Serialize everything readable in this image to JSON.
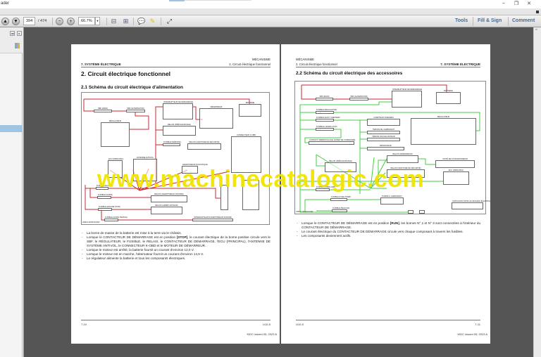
{
  "window": {
    "title": "ader",
    "minimize": "–",
    "restore": "❐",
    "close": "✕"
  },
  "toolbar": {
    "page_current": "394",
    "page_total": "/ 474",
    "zoom": "66.7%",
    "icons": [
      "previous-page-icon",
      "next-page-icon",
      "zoom-out-icon",
      "zoom-in-icon",
      "fit-page-icon",
      "fit-width-icon",
      "comment-icon",
      "highlight-icon",
      "fullscreen-icon"
    ],
    "tools": "Tools",
    "fill_sign": "Fill & Sign",
    "comment": "Comment"
  },
  "colors": {
    "wire_power": "#c8282d",
    "wire_acc": "#44cc44",
    "watermark": "#f1e400",
    "panel_selected": "#9fc5e2"
  },
  "watermark": "www.machinecatalogic.com",
  "left_page": {
    "header_left": "7. SYSTÈME ÉLECTRIQUE",
    "header_right_top": "MÉCANISME",
    "header_right": "2. Circuit électrique fonctionnel",
    "title": "2. Circuit électrique fonctionnel",
    "subtitle": "2.1 Schéma du circuit électrique d'alimentation",
    "diagram": {
      "caption": "2SBUL0005A61IFR",
      "components": [
        "SBF (MAIN)",
        "SBF (ALTERNATOR)",
        "INTERRUPTEUR DE DÉMARRAGE",
        "DÉMARREUR",
        "BATTERIE",
        "RÉGULATEUR",
        "RELAIS (PRÉCHAUFFAGE)",
        "FUSIBLE (DÉMOND)",
        "RELAIS (CEINTURE DE SÉCURITÉ)",
        "CONNECTEUR K-OBD",
        "ECU (PRINCIPAL)",
        "ANTENNE ANTIVOL",
        "AVERTISSEUR ACOUSTIQUE",
        "FUSIBLE (ECU (B))",
        "FUSIBLE (HORN)",
        "RELAIS (AVERTISSEUR SONORE)",
        "FUSIBLE (ENGINE STOP)",
        "RELAIS (ARRÊT MOTEUR)",
        "FUSIBLE (HORN SWITCH)",
        "INTERRUPTEUR D'AVERTISSEUR SONORE"
      ]
    },
    "bullets": [
      {
        "pre": "La borne de masse de la batterie est mise à la terre via le châssis.",
        "bold": "",
        "post": ""
      },
      {
        "pre": "Lorsque le CONTACTEUR DE DÉMARRAGE est en position ",
        "bold": "[STOP]",
        "post": ", le courant électrique de la borne positive circule vers le SBF, le RÉGULATEUR, le FUSIBLE, le RELAIS, le CONTACTEUR DE DÉMARRAGE, l'ECU (PRINCIPAL), l'ANTENNE DE SYSTÈME ANTIVOL, le CONNECTEUR K-OBD et le MOTEUR DE DÉMARREUR."
      },
      {
        "pre": "Lorsque le moteur est arrêté, la batterie fournit un courant d'environ 12,0 V.",
        "bold": "",
        "post": ""
      },
      {
        "pre": "Lorsque le moteur est en marche, l'alternateur fournit un courant d'environ 14,5 V.",
        "bold": "",
        "post": ""
      },
      {
        "pre": "Le régulateur alimente la batterie et tous les composants électriques.",
        "bold": "",
        "post": ""
      }
    ],
    "footer_page": "7-10",
    "footer_model": "U10-5",
    "footer_issue": "KIDC issued 05, 2023 A"
  },
  "right_page": {
    "header_left_top": "MÉCANISME",
    "header_left": "2. Circuit électrique fonctionnel",
    "header_right": "7. SYSTÈME ÉLECTRIQUE",
    "subtitle": "2.2 Schéma du circuit électrique des accessoires",
    "diagram": {
      "caption": "2SBUL0004A61IFR",
      "components": [
        "SBF (MAIN)",
        "SBF (ALTERNATOR)",
        "INTERRUPTEUR DE DÉMARRAGE",
        "BATTERIE",
        "FUSIBLE (REGULATOR)",
        "FUSIBLE (EASY CHECKER)",
        "FUSIBLE (LEVER LOCK)",
        "COMPTEUR D'HEURES",
        "RÉGULATEUR",
        "TÉMOIN DE CARBURANT",
        "TÉMOIN D'HUILE MOTEUR",
        "CONTACT (VERROUILLAGE LEVIER DE COMMANDE)",
        "RÉSISTANCE",
        "RELAIS (DÉMARREUR)",
        "UNITÉ DE SYNCHRONISEUR",
        "RELAIS (PRÉCHAUFFAGE)",
        "RELAIS (CEINTURE DE SÉCURITÉ)",
        "ECU (PRINCIPAL)",
        "FUSIBLE (WARN LMP)",
        "FUSIBLE (FUEL PUMP)",
        "POMPE À CARBURANT",
        "FUSIBLE (BEACON)",
        "CAPUCHON (VOIR LE FAISCEAU ÉLECTRIQUE (A))"
      ]
    },
    "bullets": [
      {
        "pre": "Lorsque le CONTACTEUR DE DÉMARRAGE est en position ",
        "bold": "[RUN]",
        "post": ", les bornes N° 1 et N° 3 sont connectées à l'intérieur du CONTACTEUR DE DÉMARRAGE."
      },
      {
        "pre": "Le courant électrique du CONTACTEUR DE DÉMARRAGE circule vers chaque composant à travers les fusibles.",
        "bold": "",
        "post": ""
      },
      {
        "pre": "Les composants deviennent actifs.",
        "bold": "",
        "post": ""
      }
    ],
    "footer_page": "7-11",
    "footer_model": "U10-5",
    "footer_issue": "KIDC issued 05, 2023 A"
  }
}
